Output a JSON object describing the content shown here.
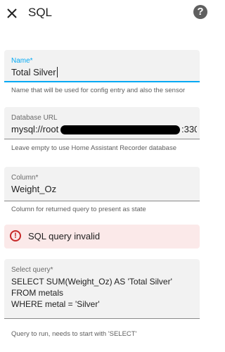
{
  "header": {
    "title": "SQL",
    "close_icon": "close-icon",
    "help_icon": "help-icon",
    "help_glyph": "?"
  },
  "fields": {
    "name": {
      "label": "Name*",
      "value": "Total Silver",
      "helper": "Name that will be used for config entry and also the sensor"
    },
    "db_url": {
      "label": "Database URL",
      "value_start": "mysql://root",
      "value_end": ":330",
      "helper": "Leave empty to use Home Assistant Recorder database"
    },
    "column": {
      "label": "Column*",
      "value": "Weight_Oz",
      "helper": "Column for returned query to present as state"
    },
    "query": {
      "label": "Select query*",
      "lines": [
        "SELECT SUM(Weight_Oz) AS 'Total Silver'",
        "FROM metals",
        "WHERE metal = 'Silver'"
      ],
      "helper": "Query to run, needs to start with 'SELECT'"
    }
  },
  "alert": {
    "text": "SQL query invalid",
    "icon": "error-icon",
    "glyph": "!"
  },
  "colors": {
    "accent": "#03a9f4",
    "error": "#c62828",
    "error_bg": "#fbe9e9",
    "field_bg": "#f2f2f2"
  }
}
